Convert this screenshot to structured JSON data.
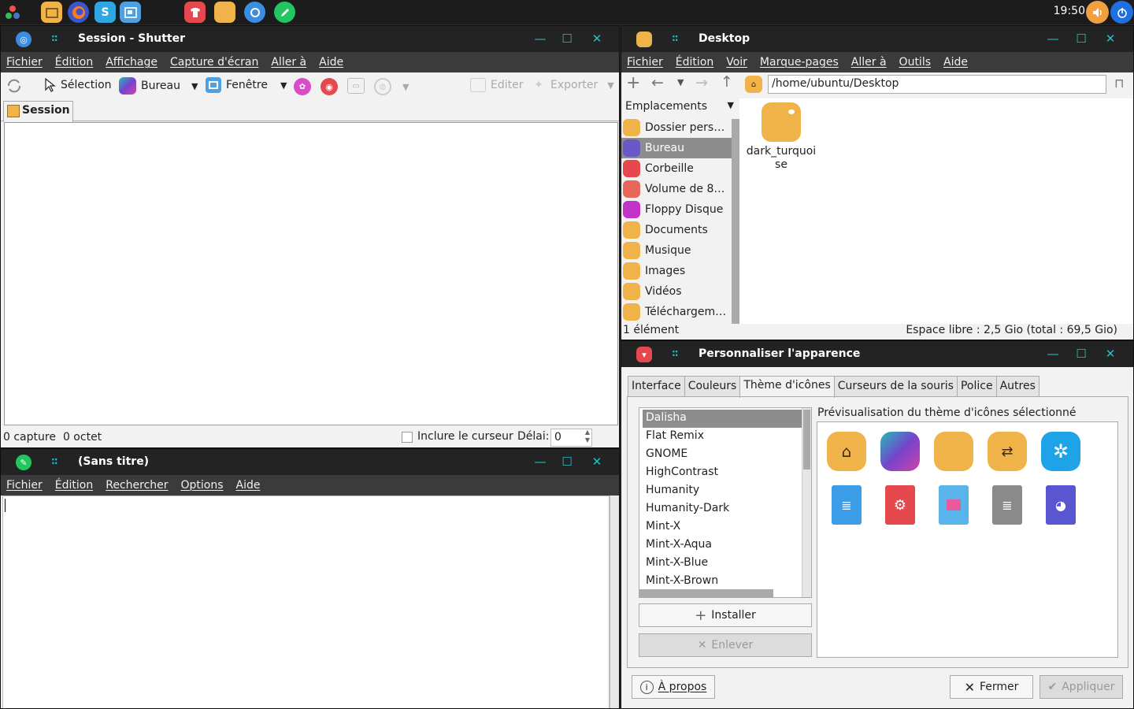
{
  "panel": {
    "clock": "19:50",
    "launchers": [
      "apps-menu-icon",
      "folder-icon",
      "firefox-icon",
      "skype-icon",
      "screenshot-icon",
      "appearance-icon",
      "files-icon",
      "shutter-icon",
      "editor-icon"
    ],
    "indicators": [
      "volume-icon",
      "power-icon"
    ]
  },
  "shutter": {
    "title": "Session - Shutter",
    "menu": [
      "Fichier",
      "Édition",
      "Affichage",
      "Capture d'écran",
      "Aller à",
      "Aide"
    ],
    "toolbar": {
      "selection": "Sélection",
      "desktop": "Bureau",
      "window": "Fenêtre",
      "edit": "Editer",
      "export": "Exporter"
    },
    "tab": "Session",
    "status": {
      "captures": "0 capture",
      "size": "0 octet",
      "include_cursor": "Inclure le curseur",
      "delay_label": "Délai:",
      "delay_value": "0"
    }
  },
  "editor": {
    "title": "(Sans titre)",
    "menu": [
      "Fichier",
      "Édition",
      "Rechercher",
      "Options",
      "Aide"
    ]
  },
  "files": {
    "title": "Desktop",
    "menu": [
      "Fichier",
      "Édition",
      "Voir",
      "Marque-pages",
      "Aller à",
      "Outils",
      "Aide"
    ],
    "address": "/home/ubuntu/Desktop",
    "sidebar_header": "Emplacements",
    "places": [
      {
        "label": "Dossier pers…",
        "icon": "home-folder-icon",
        "color": "#f0b34a"
      },
      {
        "label": "Bureau",
        "icon": "desktop-icon",
        "color": "#6a58c9"
      },
      {
        "label": "Corbeille",
        "icon": "trash-icon",
        "color": "#e5484d"
      },
      {
        "label": "Volume de 8…",
        "icon": "drive-icon",
        "color": "#e8665a"
      },
      {
        "label": "Floppy Disque",
        "icon": "floppy-icon",
        "color": "#c133c9"
      },
      {
        "label": "Documents",
        "icon": "documents-folder-icon",
        "color": "#f0b34a"
      },
      {
        "label": "Musique",
        "icon": "music-folder-icon",
        "color": "#f0b34a"
      },
      {
        "label": "Images",
        "icon": "pictures-folder-icon",
        "color": "#f0b34a"
      },
      {
        "label": "Vidéos",
        "icon": "videos-folder-icon",
        "color": "#f0b34a"
      },
      {
        "label": "Téléchargem…",
        "icon": "downloads-folder-icon",
        "color": "#f0b34a"
      }
    ],
    "items": [
      {
        "label": "dark_turquoise",
        "icon": "folder-icon"
      }
    ],
    "status_left": "1 élément",
    "status_right": "Espace libre : 2,5 Gio (total : 69,5 Gio)"
  },
  "appearance": {
    "title": "Personnaliser l'apparence",
    "tabs": [
      "Interface",
      "Couleurs",
      "Thème d'icônes",
      "Curseurs de la souris",
      "Police",
      "Autres"
    ],
    "active_tab": "Thème d'icônes",
    "themes": [
      "Dalisha",
      "Flat Remix",
      "GNOME",
      "HighContrast",
      "Humanity",
      "Humanity-Dark",
      "Mint-X",
      "Mint-X-Aqua",
      "Mint-X-Blue",
      "Mint-X-Brown"
    ],
    "selected_theme": "Dalisha",
    "preview_title": "Prévisualisation du thème d'icônes sélectionné",
    "install": "Installer",
    "remove": "Enlever",
    "about": "À propos",
    "close": "Fermer",
    "apply": "Appliquer",
    "preview_icons": [
      "home-folder-icon",
      "desktop-icon",
      "folder-icon",
      "remote-folder-icon",
      "settings-icon",
      "text-document-icon",
      "config-document-icon",
      "image-document-icon",
      "plain-document-icon",
      "web-document-icon"
    ]
  },
  "colors": {
    "accent": "#20c0c8",
    "titlebar": "#232323",
    "menubar": "#3b3b3b",
    "selection": "#8d8d8d",
    "folder": "#f0b34a"
  }
}
